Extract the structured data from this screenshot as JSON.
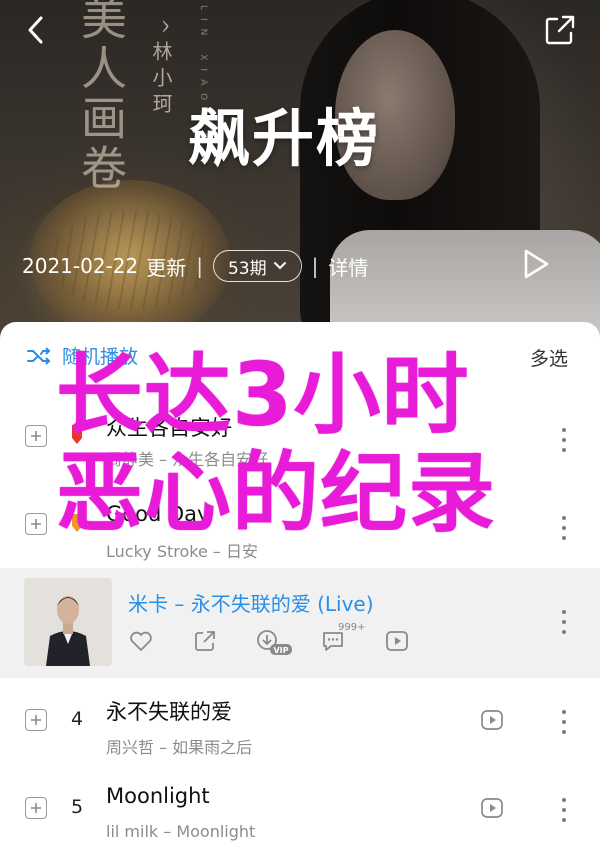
{
  "header": {
    "poster_calligraphy": "美人画卷",
    "poster_artist": "^林小珂",
    "poster_english": "LIN XIAO KE",
    "title": "飙升榜",
    "update_date": "2021-02-22",
    "update_label": "更新",
    "count_label": "53期",
    "detail_label": "详情"
  },
  "toolbar": {
    "shuffle_label": "随机播放",
    "multi_select_label": "多选"
  },
  "songs": [
    {
      "rank": "",
      "title": "众生各自安好",
      "artist": "周静美 – 众生各自安好"
    },
    {
      "rank": "",
      "title": "Good Day",
      "artist": "Lucky Stroke – 日安"
    },
    {
      "rank": "",
      "title": "米卡 – 永不失联的爱 (Live)",
      "artist": ""
    },
    {
      "rank": "4",
      "title": "永不失联的爱",
      "artist": "周兴哲 – 如果雨之后"
    },
    {
      "rank": "5",
      "title": "Moonlight",
      "artist": "lil milk – Moonlight"
    }
  ],
  "active_actions": {
    "comment_count": "999+",
    "vip_label": "VIP"
  },
  "overlay": {
    "line1": "长达3小时",
    "line2": "恶心的纪录"
  },
  "colors": {
    "accent": "#2a8ee8",
    "overlay": "#e81cd8"
  }
}
